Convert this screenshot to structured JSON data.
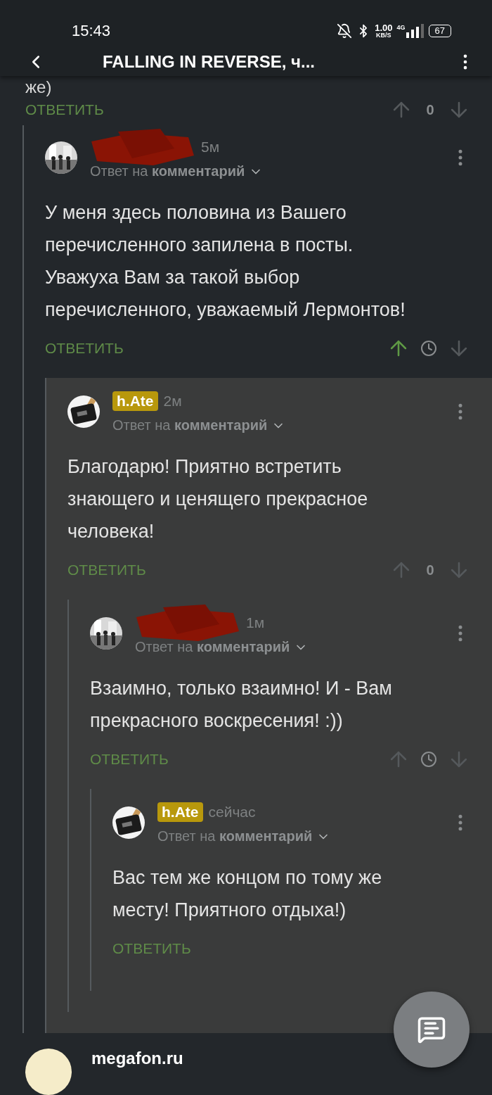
{
  "status_bar": {
    "time": "15:43",
    "speed_value": "1.00",
    "speed_unit": "KB/S",
    "network": "4G",
    "battery": "67"
  },
  "header": {
    "title": "FALLING IN REVERSE, ч..."
  },
  "previous_comment": {
    "text_tail": "же)",
    "reply_label": "ОТВЕТИТЬ",
    "vote": {
      "kind": "score",
      "score": "0",
      "upvoted": false
    }
  },
  "comments": [
    {
      "author": {
        "redacted": true
      },
      "time": "5м",
      "reply_to": {
        "prefix": "Ответ на",
        "target": "комментарий"
      },
      "text": "У меня здесь половина из Вашего перечисленного запилена в посты. Уважуха Вам за такой выбор перечисленного, уважаемый Лермонтов!",
      "reply_label": "ОТВЕТИТЬ",
      "vote": {
        "kind": "pending",
        "upvoted": true
      },
      "children": [
        {
          "author": {
            "redacted": false,
            "name": "h.Ate"
          },
          "time": "2м",
          "reply_to": {
            "prefix": "Ответ на",
            "target": "комментарий"
          },
          "text": "Благодарю! Приятно встретить знающего и ценящего прекрасное человека!",
          "reply_label": "ОТВЕТИТЬ",
          "vote": {
            "kind": "score",
            "score": "0",
            "upvoted": false
          },
          "children": [
            {
              "author": {
                "redacted": true
              },
              "time": "1м",
              "reply_to": {
                "prefix": "Ответ на",
                "target": "комментарий"
              },
              "text": "Взаимно, только взаимно! И - Вам прекрасного воскресения! :))",
              "reply_label": "ОТВЕТИТЬ",
              "vote": {
                "kind": "pending",
                "upvoted": false
              },
              "children": [
                {
                  "author": {
                    "redacted": false,
                    "name": "h.Ate"
                  },
                  "time": "сейчас",
                  "reply_to": {
                    "prefix": "Ответ на",
                    "target": "комментарий"
                  },
                  "text": "Вас тем же концом по тому же месту! Приятного отдыха!)",
                  "reply_label": "ОТВЕТИТЬ"
                }
              ]
            }
          ]
        }
      ]
    }
  ],
  "next_post": {
    "author": "megafon.ru"
  }
}
